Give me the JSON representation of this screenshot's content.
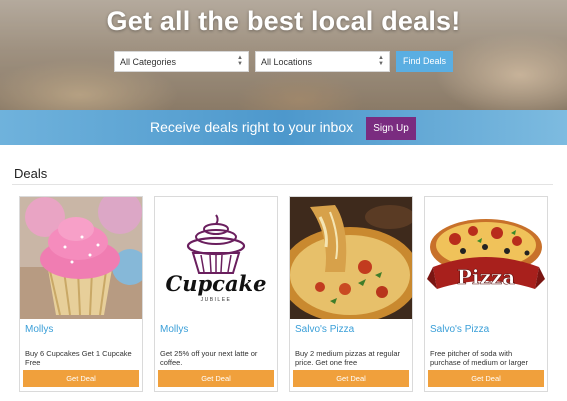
{
  "hero": {
    "title": "Get all the best local deals!",
    "category_select": "All Categories",
    "location_select": "All Locations",
    "find_button": "Find Deals"
  },
  "signup_band": {
    "text": "Receive deals right to your inbox",
    "button": "Sign Up"
  },
  "deals": {
    "heading": "Deals",
    "button_label": "Get Deal",
    "cards": [
      {
        "merchant": "Mollys",
        "description": "Buy 6 Cupcakes Get 1 Cupcake Free",
        "image": "cupcakes-photo"
      },
      {
        "merchant": "Mollys",
        "description": "Get 25% off your next latte or coffee.",
        "image": "cupcake-jubilee-logo",
        "logo_text": "Cupcake",
        "logo_subtext": "JUBILEE"
      },
      {
        "merchant": "Salvo's Pizza",
        "description": "Buy 2 medium pizzas at regular price. Get one free",
        "image": "pizza-photo"
      },
      {
        "merchant": "Salvo's Pizza",
        "description": "Free pitcher of soda with purchase of medium or larger",
        "image": "pizza-logo",
        "logo_text": "Pizza"
      }
    ]
  },
  "colors": {
    "accent_blue": "#5aaee2",
    "signup_purple": "#7a2c80",
    "deal_orange": "#f0a03c",
    "merchant_link": "#3a9fd8"
  }
}
